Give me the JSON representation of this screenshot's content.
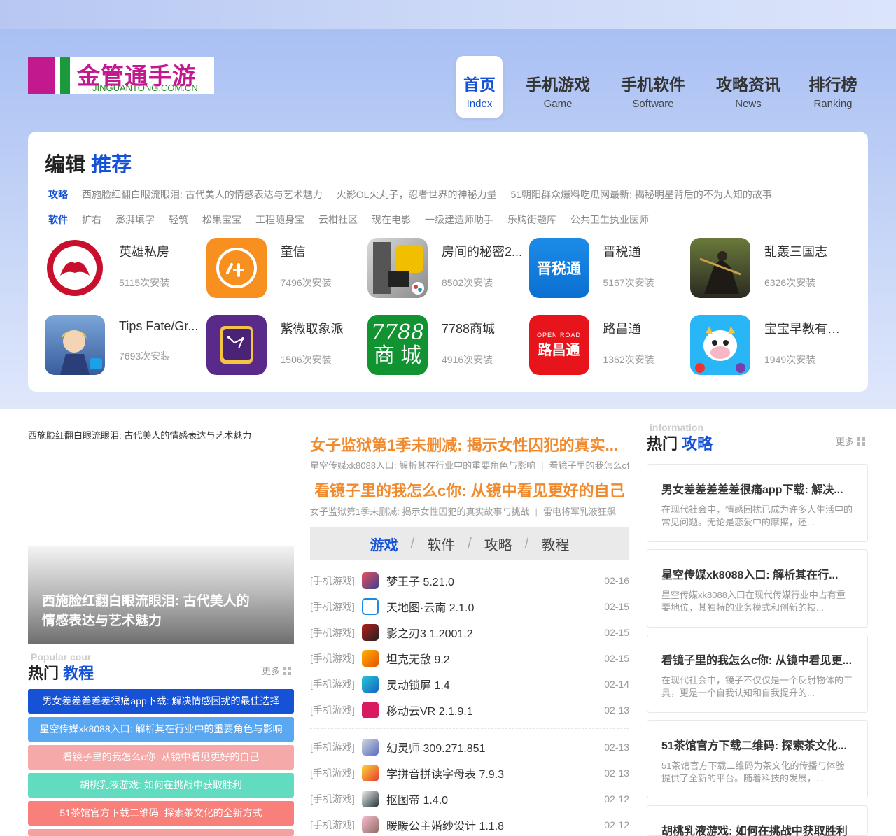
{
  "logo": {
    "cn": "金管通手游",
    "en": "JINGUANTONG.COM.CN"
  },
  "nav": [
    {
      "zh": "首页",
      "en": "Index"
    },
    {
      "zh": "手机游戏",
      "en": "Game"
    },
    {
      "zh": "手机软件",
      "en": "Software"
    },
    {
      "zh": "攻略资讯",
      "en": "News"
    },
    {
      "zh": "排行榜",
      "en": "Ranking"
    }
  ],
  "editor": {
    "title_a": "编辑",
    "title_b": "推荐",
    "guide_label": "攻略",
    "guides": [
      "西施脸红翻白眼流眼泪: 古代美人的情感表达与艺术魅力",
      "火影OL火丸子，忍者世界的神秘力量",
      "51朝阳群众爆料吃瓜网最新: 揭秘明星背后的不为人知的故事"
    ],
    "soft_label": "软件",
    "softs": [
      "扩右",
      "澎湃填字",
      "轻筑",
      "松果宝宝",
      "工程随身宝",
      "云柑社区",
      "现在电影",
      "一级建造师助手",
      "乐购街题库",
      "公共卫生执业医师"
    ],
    "apps": [
      {
        "name": "英雄私房",
        "installs": "5115次安装"
      },
      {
        "name": "童信",
        "installs": "7496次安装"
      },
      {
        "name": "房间的秘密2...",
        "installs": "8502次安装"
      },
      {
        "name": "晋税通",
        "installs": "5167次安装"
      },
      {
        "name": "乱轰三国志",
        "installs": "6326次安装"
      },
      {
        "name": "Tips Fate/Gr...",
        "installs": "7693次安装"
      },
      {
        "name": "紫微取象派",
        "installs": "1506次安装"
      },
      {
        "name": "7788商城",
        "installs": "4916次安装"
      },
      {
        "name": "路昌通",
        "installs": "1362次安装"
      },
      {
        "name": "宝宝早教有声...",
        "installs": "1949次安装"
      }
    ],
    "icon_text": {
      "tongxin": "⼈⽊",
      "jinshuitong": "晋税通",
      "mall_top": "7788",
      "mall_bottom": "商 城",
      "luchang": "路昌通",
      "luchang_top": "OPEN ROAD"
    }
  },
  "left": {
    "slide_caption": "西施脸红翻白眼流眼泪: 古代美人的情感表达与艺术魅力",
    "slide_title": "西施脸红翻白眼流眼泪: 古代美人的情感表达与艺术魅力",
    "hot_ghost": "Popular cour",
    "hot_a": "热门",
    "hot_b": "教程",
    "more": "更多",
    "hot_items": [
      "男女差差差差差很痛app下载: 解决情感困扰的最佳选择",
      "星空传媒xk8088入口: 解析其在行业中的重要角色与影响",
      "看镜子里的我怎么c你: 从镜中看见更好的自己",
      "胡桃乳液游戏: 如何在挑战中获取胜利",
      "51茶馆官方下载二维码: 探索茶文化的全新方式"
    ]
  },
  "mid": {
    "headline1": "女子监狱第1季未删减: 揭示女性囚犯的真实...",
    "sub1_a": "星空传媒xk8088入口: 解析其在行业中的重要角色与影响",
    "sub1_b": "看镜子里的我怎么c你: 从镜中看见更好的自己",
    "headline2": "看镜子里的我怎么c你: 从镜中看见更好的自己",
    "sub2_a": "女子监狱第1季未删减: 揭示女性囚犯的真实故事与挑战",
    "sub2_b": "雷电将军乳液狂飙",
    "tabs": [
      "游戏",
      "软件",
      "攻略",
      "教程"
    ],
    "games_a": [
      {
        "cat": "[手机游戏]",
        "name": "梦王子 5.21.0",
        "date": "02-16"
      },
      {
        "cat": "[手机游戏]",
        "name": "天地图·云南 2.1.0",
        "date": "02-15"
      },
      {
        "cat": "[手机游戏]",
        "name": "影之刃3 1.2001.2",
        "date": "02-15"
      },
      {
        "cat": "[手机游戏]",
        "name": "坦克无敌 9.2",
        "date": "02-15"
      },
      {
        "cat": "[手机游戏]",
        "name": "灵动锁屏 1.4",
        "date": "02-14"
      },
      {
        "cat": "[手机游戏]",
        "name": "移动云VR 2.1.9.1",
        "date": "02-13"
      }
    ],
    "games_b": [
      {
        "cat": "[手机游戏]",
        "name": "幻灵师 309.271.851",
        "date": "02-13"
      },
      {
        "cat": "[手机游戏]",
        "name": "学拼音拼读字母表 7.9.3",
        "date": "02-13"
      },
      {
        "cat": "[手机游戏]",
        "name": "抠图帝 1.4.0",
        "date": "02-12"
      },
      {
        "cat": "[手机游戏]",
        "name": "暖暖公主婚纱设计 1.1.8",
        "date": "02-12"
      }
    ]
  },
  "right": {
    "ghost": "information",
    "title_a": "热门",
    "title_b": "攻略",
    "more": "更多",
    "cards": [
      {
        "title": "男女差差差差差很痛app下载: 解决...",
        "desc": "在现代社会中，情感困扰已成为许多人生活中的常见问题。无论是恋爱中的摩擦，还..."
      },
      {
        "title": "星空传媒xk8088入口: 解析其在行...",
        "desc": "星空传媒xk8088入口在现代传媒行业中占有重要地位，其独特的业务模式和创新的技..."
      },
      {
        "title": "看镜子里的我怎么c你: 从镜中看见更...",
        "desc": "在现代社会中，镜子不仅仅是一个反射物体的工具，更是一个自我认知和自我提升的..."
      },
      {
        "title": "51茶馆官方下载二维码: 探索茶文化...",
        "desc": "51茶馆官方下载二维码为茶文化的传播与体验提供了全新的平台。随着科技的发展，..."
      },
      {
        "title": "胡桃乳液游戏: 如何在挑战中获取胜利",
        "desc": ""
      }
    ]
  },
  "colors": {
    "accent": "#1552d6",
    "orange": "#f08a2c"
  }
}
